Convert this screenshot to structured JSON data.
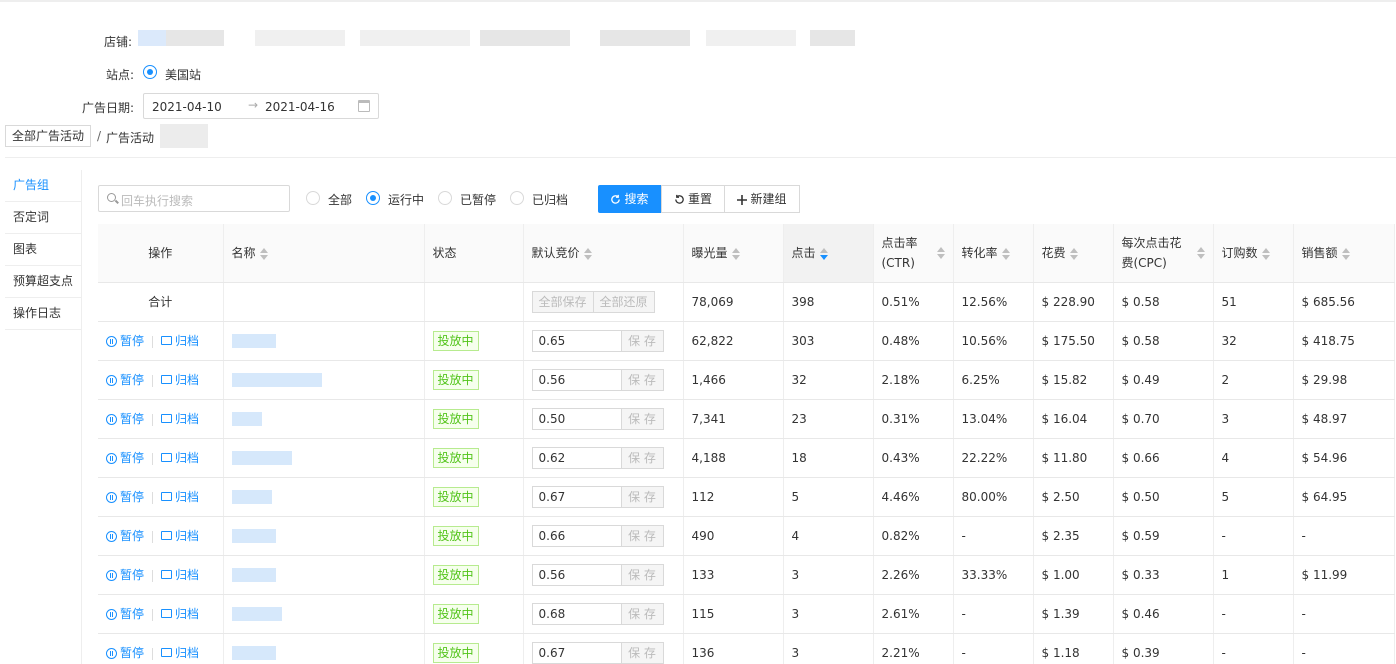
{
  "store": {
    "label": "店铺:"
  },
  "site": {
    "label": "站点:",
    "option": "美国站"
  },
  "date": {
    "label": "广告日期:",
    "start": "2021-04-10",
    "arrow": "→",
    "end": "2021-04-16"
  },
  "breadcrumb": {
    "root": "全部广告活动",
    "sep": "/",
    "current": "广告活动"
  },
  "sidenav": [
    "广告组",
    "否定词",
    "图表",
    "预算超支点",
    "操作日志"
  ],
  "search": {
    "placeholder": "回车执行搜索"
  },
  "filters": [
    "全部",
    "运行中",
    "已暂停",
    "已归档"
  ],
  "buttons": {
    "search": "搜索",
    "reset": "重置",
    "new_group": "新建组"
  },
  "columns": {
    "action": "操作",
    "name": "名称",
    "status": "状态",
    "bid": "默认竞价",
    "impressions": "曝光量",
    "clicks": "点击",
    "ctr_1": "点击率",
    "ctr_2": "(CTR)",
    "cvr": "转化率",
    "spend": "花费",
    "cpc_1": "每次点击花",
    "cpc_2": "费(CPC)",
    "orders": "订购数",
    "sales": "销售额"
  },
  "total": {
    "label": "合计",
    "save_all": "全部保存",
    "restore_all": "全部还原",
    "impressions": "78,069",
    "clicks": "398",
    "ctr": "0.51%",
    "cvr": "12.56%",
    "spend": "$ 228.90",
    "cpc": "$ 0.58",
    "orders": "51",
    "sales": "$ 685.56"
  },
  "row_labels": {
    "pause": "暂停",
    "archive": "归档",
    "status": "投放中",
    "save": "保 存"
  },
  "rows": [
    {
      "bid": "0.65",
      "impressions": "62,822",
      "clicks": "303",
      "ctr": "0.48%",
      "cvr": "10.56%",
      "spend": "$ 175.50",
      "cpc": "$ 0.58",
      "orders": "32",
      "sales": "$ 418.75"
    },
    {
      "bid": "0.56",
      "impressions": "1,466",
      "clicks": "32",
      "ctr": "2.18%",
      "cvr": "6.25%",
      "spend": "$ 15.82",
      "cpc": "$ 0.49",
      "orders": "2",
      "sales": "$ 29.98"
    },
    {
      "bid": "0.50",
      "impressions": "7,341",
      "clicks": "23",
      "ctr": "0.31%",
      "cvr": "13.04%",
      "spend": "$ 16.04",
      "cpc": "$ 0.70",
      "orders": "3",
      "sales": "$ 48.97"
    },
    {
      "bid": "0.62",
      "impressions": "4,188",
      "clicks": "18",
      "ctr": "0.43%",
      "cvr": "22.22%",
      "spend": "$ 11.80",
      "cpc": "$ 0.66",
      "orders": "4",
      "sales": "$ 54.96"
    },
    {
      "bid": "0.67",
      "impressions": "112",
      "clicks": "5",
      "ctr": "4.46%",
      "cvr": "80.00%",
      "spend": "$ 2.50",
      "cpc": "$ 0.50",
      "orders": "5",
      "sales": "$ 64.95"
    },
    {
      "bid": "0.66",
      "impressions": "490",
      "clicks": "4",
      "ctr": "0.82%",
      "cvr": "-",
      "spend": "$ 2.35",
      "cpc": "$ 0.59",
      "orders": "-",
      "sales": "-"
    },
    {
      "bid": "0.56",
      "impressions": "133",
      "clicks": "3",
      "ctr": "2.26%",
      "cvr": "33.33%",
      "spend": "$ 1.00",
      "cpc": "$ 0.33",
      "orders": "1",
      "sales": "$ 11.99"
    },
    {
      "bid": "0.68",
      "impressions": "115",
      "clicks": "3",
      "ctr": "2.61%",
      "cvr": "-",
      "spend": "$ 1.39",
      "cpc": "$ 0.46",
      "orders": "-",
      "sales": "-"
    },
    {
      "bid": "0.67",
      "impressions": "136",
      "clicks": "3",
      "ctr": "2.21%",
      "cvr": "-",
      "spend": "$ 1.18",
      "cpc": "$ 0.39",
      "orders": "-",
      "sales": "-"
    }
  ],
  "colors": {
    "primary": "#1890ff",
    "tag_green": "#52c41a",
    "tag_bg": "#f6ffed"
  }
}
